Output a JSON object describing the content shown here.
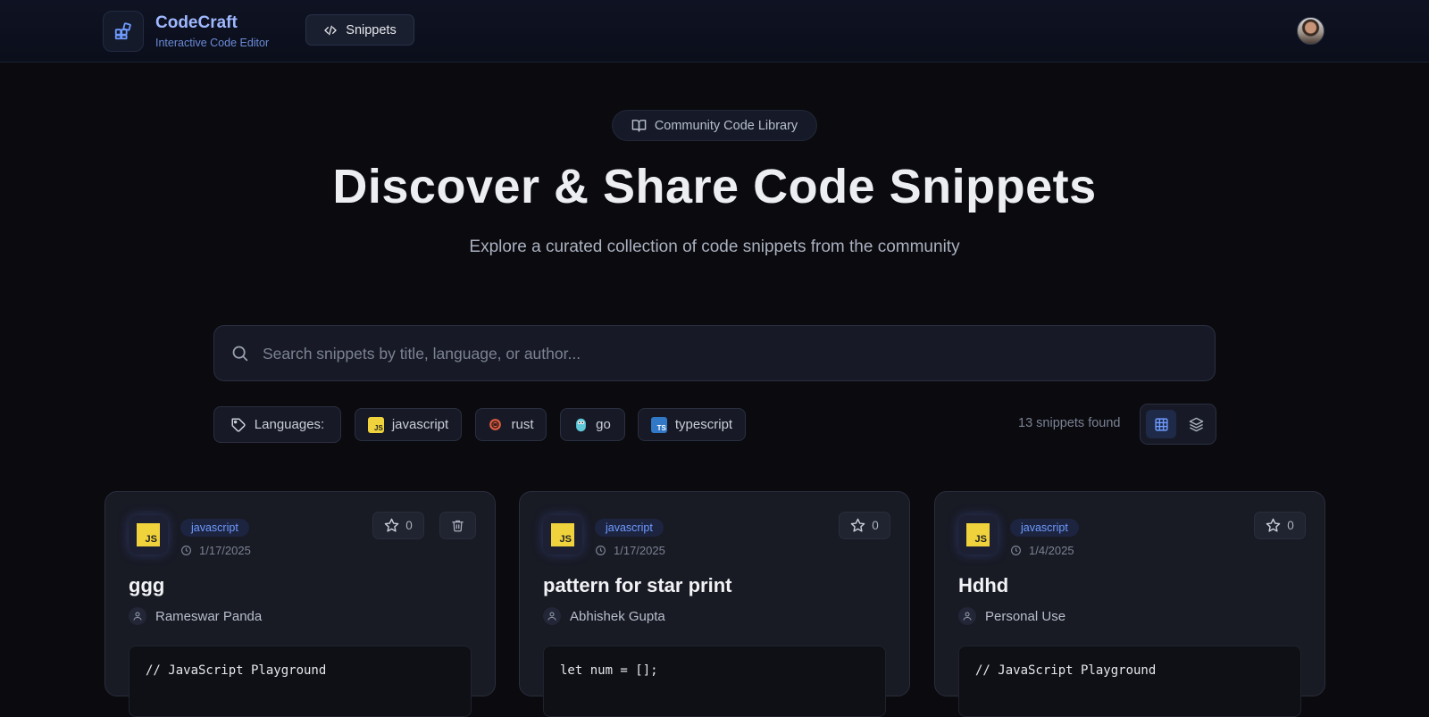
{
  "header": {
    "brand_title": "CodeCraft",
    "brand_subtitle": "Interactive Code Editor",
    "nav_snippets": "Snippets"
  },
  "hero": {
    "badge": "Community Code Library",
    "title": "Discover & Share Code Snippets",
    "subtitle": "Explore a curated collection of code snippets from the community"
  },
  "search": {
    "placeholder": "Search snippets by title, language, or author..."
  },
  "filters": {
    "label": "Languages:",
    "languages": [
      "javascript",
      "rust",
      "go",
      "typescript"
    ],
    "count_text": "13 snippets found"
  },
  "cards": [
    {
      "language": "javascript",
      "date": "1/17/2025",
      "stars": "0",
      "title": "ggg",
      "author": "Rameswar Panda",
      "code": "// JavaScript Playground"
    },
    {
      "language": "javascript",
      "date": "1/17/2025",
      "stars": "0",
      "title": "pattern for star print",
      "author": "Abhishek Gupta",
      "code": "let num = [];"
    },
    {
      "language": "javascript",
      "date": "1/4/2025",
      "stars": "0",
      "title": "Hdhd",
      "author": "Personal Use",
      "code": "// JavaScript Playground"
    }
  ],
  "colors": {
    "background": "#0a0a0f",
    "accent": "#6f9bff",
    "js_yellow": "#f0d33c"
  }
}
